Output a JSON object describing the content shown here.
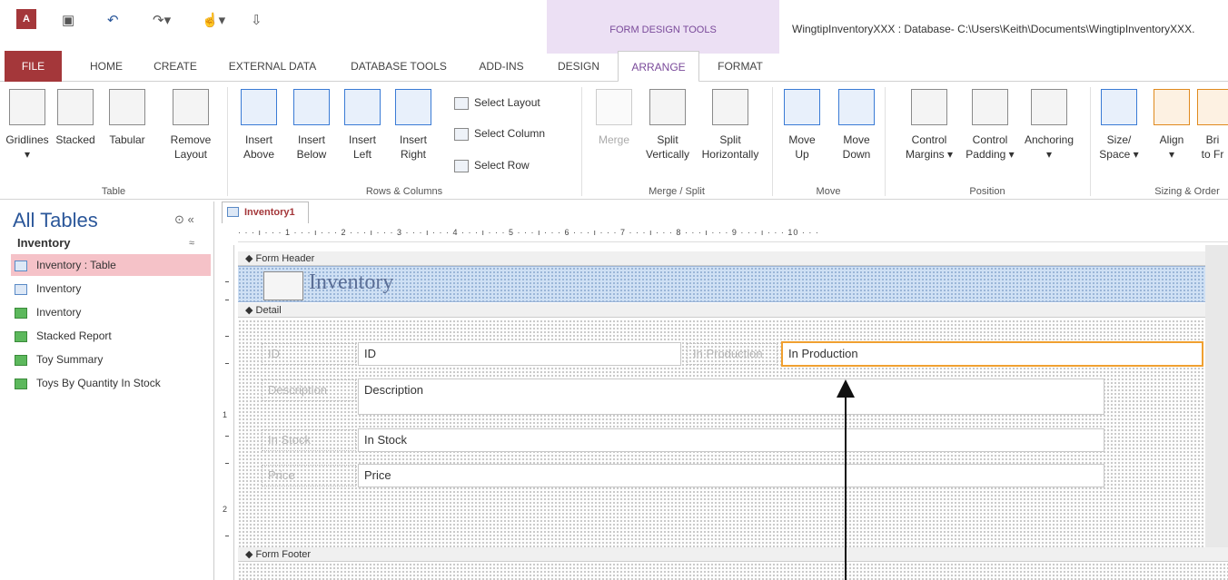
{
  "app": {
    "doc_title": "WingtipInventoryXXX : Database- C:\\Users\\Keith\\Documents\\WingtipInventoryXXX.",
    "context_tab_label": "FORM DESIGN TOOLS",
    "icons": [
      "access-icon",
      "save-icon",
      "undo-icon",
      "redo-icon",
      "touch-mode-icon",
      "customize-qa-icon"
    ]
  },
  "tabs": [
    "FILE",
    "HOME",
    "CREATE",
    "EXTERNAL DATA",
    "DATABASE TOOLS",
    "ADD-INS",
    "DESIGN",
    "ARRANGE",
    "FORMAT"
  ],
  "ribbon": {
    "table_group": {
      "label": "Table",
      "buttons": [
        {
          "l1": "Gridlines",
          "l2": "▾"
        },
        {
          "l1": "Stacked",
          "l2": ""
        },
        {
          "l1": "Tabular",
          "l2": ""
        },
        {
          "l1": "Remove",
          "l2": "Layout"
        }
      ]
    },
    "rows_group": {
      "label": "Rows & Columns",
      "buttons": [
        {
          "l1": "Insert",
          "l2": "Above"
        },
        {
          "l1": "Insert",
          "l2": "Below"
        },
        {
          "l1": "Insert",
          "l2": "Left"
        },
        {
          "l1": "Insert",
          "l2": "Right"
        }
      ],
      "select": [
        "Select Layout",
        "Select Column",
        "Select Row"
      ]
    },
    "merge_group": {
      "label": "Merge / Split",
      "buttons": [
        {
          "l1": "Merge",
          "l2": ""
        },
        {
          "l1": "Split",
          "l2": "Vertically"
        },
        {
          "l1": "Split",
          "l2": "Horizontally"
        }
      ]
    },
    "move_group": {
      "label": "Move",
      "buttons": [
        {
          "l1": "Move",
          "l2": "Up"
        },
        {
          "l1": "Move",
          "l2": "Down"
        }
      ]
    },
    "position_group": {
      "label": "Position",
      "buttons": [
        {
          "l1": "Control",
          "l2": "Margins ▾"
        },
        {
          "l1": "Control",
          "l2": "Padding ▾"
        },
        {
          "l1": "Anchoring",
          "l2": "▾"
        }
      ]
    },
    "sizing_group": {
      "label": "Sizing & Order",
      "buttons": [
        {
          "l1": "Size/",
          "l2": "Space ▾"
        },
        {
          "l1": "Align",
          "l2": "▾"
        },
        {
          "l1": "Bri",
          "l2": "to Fr"
        }
      ]
    }
  },
  "nav": {
    "title": "All Tables",
    "ctrl": "⊙ «",
    "group": "Inventory",
    "group_chev": "≈",
    "items": [
      "Inventory : Table",
      "Inventory",
      "Inventory",
      "Stacked Report",
      "Toy Summary",
      "Toys By Quantity In Stock"
    ]
  },
  "document": {
    "tab": "Inventory1",
    "ruler": "· · · ı · · · 1 · · · ı · · · 2 · · · ı · · · 3 · · · ı · · · 4 · · · ı · · · 5 · · · ı · · · 6 · · · ı · · · 7 · · · ı · · · 8 · · · ı · · · 9 · · · ı · · · 10 · · ·",
    "vruler_numbers": [
      "1",
      "2"
    ],
    "sections": {
      "header": "Form Header",
      "detail": "Detail",
      "footer": "Form Footer"
    },
    "form_title": "Inventory",
    "labels": {
      "id": "ID",
      "in_production": "In Production",
      "description": "Description",
      "in_stock": "In Stock",
      "price": "Price"
    },
    "fields": {
      "id": "ID",
      "in_production": "In Production",
      "description": "Description",
      "in_stock": "In Stock",
      "price": "Price"
    }
  },
  "colors": {
    "accent": "#a4373a",
    "context": "#ece0f4",
    "arrange": "#7a4a9a",
    "selected_border": "#f0a030"
  }
}
